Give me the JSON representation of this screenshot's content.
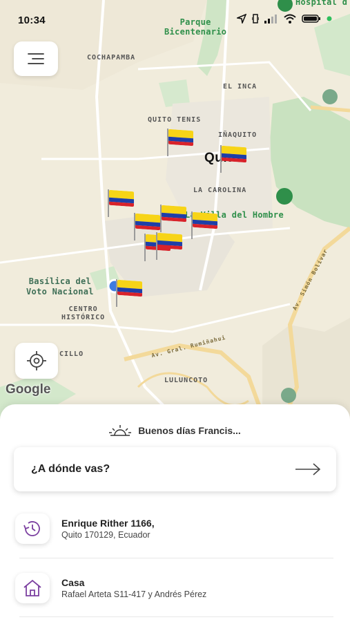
{
  "status_bar": {
    "time": "10:34",
    "icons": [
      "location-arrow-icon",
      "vibrate-icon",
      "signal-icon",
      "wifi-icon",
      "battery-icon",
      "dot-icon"
    ]
  },
  "map": {
    "labels": {
      "parque_bicentenario": "Parque\nBicentenario",
      "hospital": "Hospital d",
      "cochapamba": "COCHAPAMBA",
      "el_inca": "EL INCA",
      "quito_tenis": "QUITO TENIS",
      "inaquito": "IÑAQUITO",
      "quito": "Quito",
      "la_carolina": "LA CAROLINA",
      "villa_del_hombre": "La Villa del Hombre",
      "basilica": "Basílica del\nVoto Nacional",
      "centro_historico": "CENTRO\nHISTÓRICO",
      "cillo": "CILLO",
      "av_rumi": "Av. Gral. Rumiñahui",
      "av_simon": "Av. Simón Bolívar",
      "lulunc": "LULUNCOTO"
    },
    "attribution": "Google",
    "colors": {
      "map_bg": "#f1ecdc",
      "park": "#cfe5c6",
      "road": "#ffffff",
      "highway": "#f3d99a",
      "pin": "#2f8f4a",
      "user_location": "#3f7be0"
    }
  },
  "buttons": {
    "menu_icon": "menu-icon",
    "locate_icon": "locate-icon"
  },
  "sheet": {
    "greeting": "Buenos días Francis...",
    "search_label": "¿A dónde vas?",
    "places": [
      {
        "icon": "history-icon",
        "title": "Enrique Rither 1166,",
        "subtitle": "Quito 170129, Ecuador"
      },
      {
        "icon": "home-icon",
        "title": "Casa",
        "subtitle": "Rafael Arteta S11-417 y Andrés Pérez"
      }
    ],
    "accent": "#7b3fa0"
  }
}
